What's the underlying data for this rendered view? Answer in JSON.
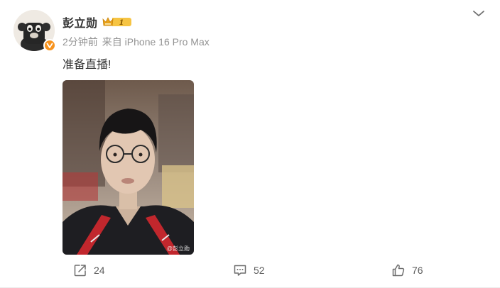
{
  "user": {
    "name": "彭立勋",
    "vip_level": "1",
    "avatar_icon": "avatar-photo",
    "verified_badge_icon": "verified-v-icon"
  },
  "meta": {
    "time": "2分钟前",
    "source": "来自 iPhone 16 Pro Max"
  },
  "post": {
    "text": "准备直播!",
    "image": {
      "description_icon": "post-photo",
      "watermark": "@彭立勋"
    }
  },
  "actions": {
    "repost": {
      "icon": "repost-icon",
      "count": "24"
    },
    "comment": {
      "icon": "comment-icon",
      "count": "52"
    },
    "like": {
      "icon": "like-icon",
      "count": "76"
    }
  },
  "menu": {
    "icon": "chevron-down-icon"
  },
  "colors": {
    "badge_orange": "#f7931e",
    "vip_gold": "#f6c443",
    "meta_gray": "#939393"
  }
}
